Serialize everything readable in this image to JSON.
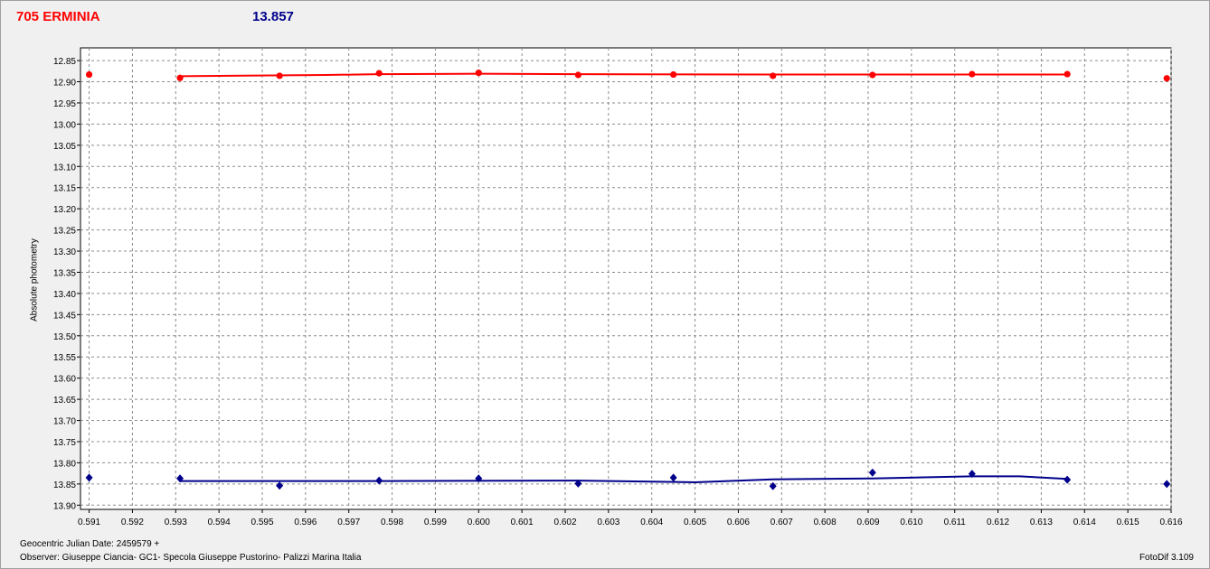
{
  "header": {
    "object_name": "705 ERMINIA",
    "magnitude": "13.857"
  },
  "footer": {
    "julian_date": "Geocentric Julian Date: 2459579 +",
    "observer": "Observer: Giuseppe Ciancia- GC1- Specola Giuseppe Pustorino- Palizzi Marina Italia",
    "software": "FotoDif 3.109"
  },
  "colors": {
    "series_red": "#ff0000",
    "series_blue": "#00008b",
    "grid": "#8c8c8c"
  },
  "chart_data": {
    "type": "line",
    "title": "705 ERMINIA",
    "ylabel": "Absolute photometry",
    "xlabel": "",
    "xlim": [
      0.5908,
      0.616
    ],
    "ylim": [
      12.82,
      13.91
    ],
    "y_inverted": true,
    "grid": true,
    "x_ticks": [
      "0.591",
      "0.592",
      "0.593",
      "0.594",
      "0.595",
      "0.596",
      "0.597",
      "0.598",
      "0.599",
      "0.600",
      "0.601",
      "0.602",
      "0.603",
      "0.604",
      "0.605",
      "0.606",
      "0.607",
      "0.608",
      "0.609",
      "0.610",
      "0.611",
      "0.612",
      "0.613",
      "0.614",
      "0.615",
      "0.616"
    ],
    "y_ticks": [
      "12.85",
      "12.90",
      "12.95",
      "13.00",
      "13.05",
      "13.10",
      "13.15",
      "13.20",
      "13.25",
      "13.30",
      "13.35",
      "13.40",
      "13.45",
      "13.50",
      "13.55",
      "13.60",
      "13.65",
      "13.70",
      "13.75",
      "13.80",
      "13.85",
      "13.90"
    ],
    "series": [
      {
        "color": "#ff0000",
        "marker": "circle",
        "points": [
          {
            "x": 0.591,
            "y": 12.883
          },
          {
            "x": 0.5931,
            "y": 12.891
          },
          {
            "x": 0.5954,
            "y": 12.886
          },
          {
            "x": 0.5977,
            "y": 12.88
          },
          {
            "x": 0.6,
            "y": 12.879
          },
          {
            "x": 0.6023,
            "y": 12.884
          },
          {
            "x": 0.6045,
            "y": 12.883
          },
          {
            "x": 0.6068,
            "y": 12.886
          },
          {
            "x": 0.6091,
            "y": 12.884
          },
          {
            "x": 0.6114,
            "y": 12.882
          },
          {
            "x": 0.6136,
            "y": 12.882
          },
          {
            "x": 0.6159,
            "y": 12.892
          }
        ],
        "fit": [
          {
            "x": 0.5931,
            "y": 12.887
          },
          {
            "x": 0.5965,
            "y": 12.884
          },
          {
            "x": 0.5977,
            "y": 12.882
          },
          {
            "x": 0.6,
            "y": 12.881
          },
          {
            "x": 0.6023,
            "y": 12.882
          },
          {
            "x": 0.6068,
            "y": 12.883
          },
          {
            "x": 0.6136,
            "y": 12.883
          }
        ]
      },
      {
        "color": "#00008b",
        "marker": "diamond",
        "points": [
          {
            "x": 0.591,
            "y": 13.835
          },
          {
            "x": 0.5931,
            "y": 13.837
          },
          {
            "x": 0.5954,
            "y": 13.854
          },
          {
            "x": 0.5977,
            "y": 13.842
          },
          {
            "x": 0.6,
            "y": 13.837
          },
          {
            "x": 0.6023,
            "y": 13.849
          },
          {
            "x": 0.6045,
            "y": 13.835
          },
          {
            "x": 0.6068,
            "y": 13.855
          },
          {
            "x": 0.6091,
            "y": 13.823
          },
          {
            "x": 0.6114,
            "y": 13.826
          },
          {
            "x": 0.6136,
            "y": 13.84
          },
          {
            "x": 0.6159,
            "y": 13.85
          }
        ],
        "fit": [
          {
            "x": 0.5931,
            "y": 13.843
          },
          {
            "x": 0.5977,
            "y": 13.843
          },
          {
            "x": 0.6023,
            "y": 13.842
          },
          {
            "x": 0.605,
            "y": 13.846
          },
          {
            "x": 0.6068,
            "y": 13.839
          },
          {
            "x": 0.6091,
            "y": 13.837
          },
          {
            "x": 0.6114,
            "y": 13.832
          },
          {
            "x": 0.6125,
            "y": 13.832
          },
          {
            "x": 0.6136,
            "y": 13.838
          }
        ]
      }
    ]
  }
}
